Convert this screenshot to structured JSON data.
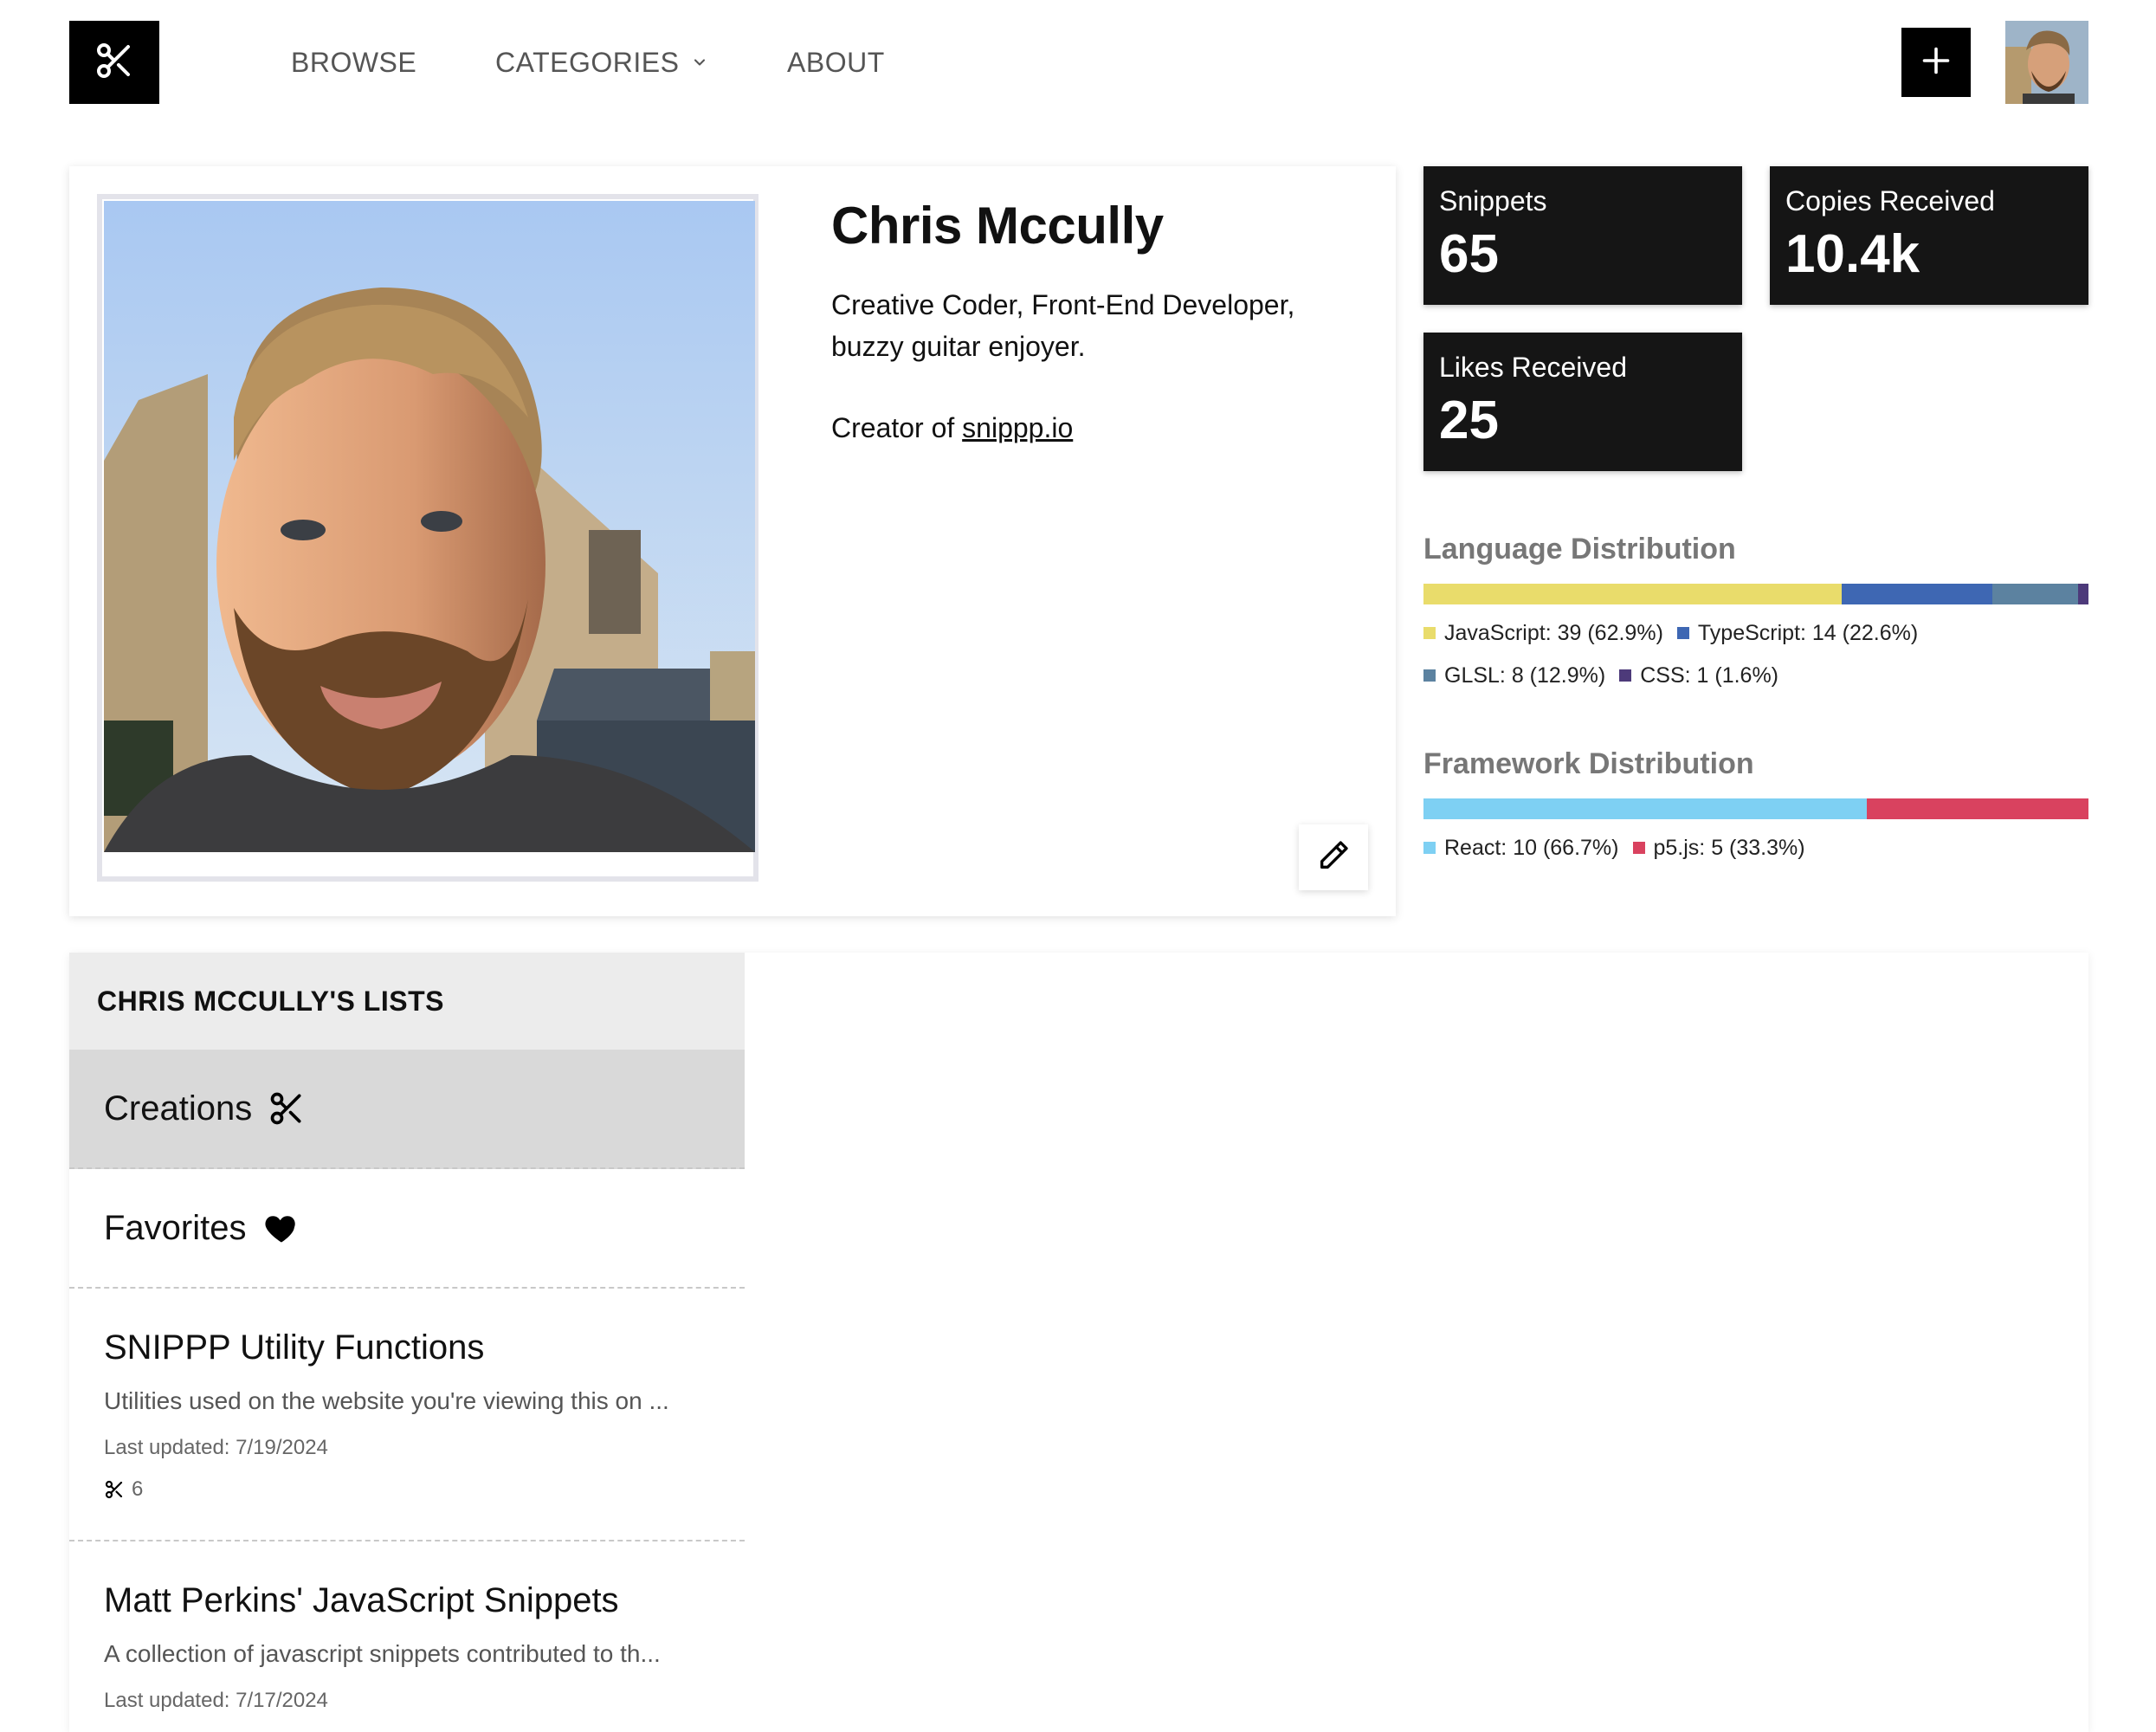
{
  "header": {
    "nav": {
      "browse": "BROWSE",
      "categories": "CATEGORIES",
      "about": "ABOUT"
    },
    "icons": {
      "logo": "scissors-icon",
      "add": "plus-icon",
      "dropdown": "chevron-down-icon"
    }
  },
  "profile": {
    "name": "Chris Mccully",
    "bio": "Creative Coder, Front-End Developer, buzzy guitar enjoyer.",
    "creator_prefix": "Creator of",
    "creator_link": "snippp.io",
    "edit_icon": "pencil-icon"
  },
  "stats": {
    "snippets": {
      "label": "Snippets",
      "value": "65"
    },
    "copies": {
      "label": "Copies Received",
      "value": "10.4k"
    },
    "likes": {
      "label": "Likes Received",
      "value": "25"
    }
  },
  "language_distribution": {
    "title": "Language Distribution",
    "items": [
      {
        "label": "JavaScript: 39 (62.9%)",
        "percent": 62.9,
        "color": "#e9dc6b"
      },
      {
        "label": "TypeScript: 14 (22.6%)",
        "percent": 22.6,
        "color": "#3e67b3"
      },
      {
        "label": "GLSL: 8 (12.9%)",
        "percent": 12.9,
        "color": "#5c82a0"
      },
      {
        "label": "CSS: 1 (1.6%)",
        "percent": 1.6,
        "color": "#4d3a7a"
      }
    ]
  },
  "framework_distribution": {
    "title": "Framework Distribution",
    "items": [
      {
        "label": "React: 10 (66.7%)",
        "percent": 66.7,
        "color": "#7ed0f3"
      },
      {
        "label": "p5.js: 5 (33.3%)",
        "percent": 33.3,
        "color": "#d9425f"
      }
    ]
  },
  "lists": {
    "header": "CHRIS MCCULLY'S LISTS",
    "creations": "Creations",
    "favorites": "Favorites",
    "items": [
      {
        "title": "SNIPPP Utility Functions",
        "description": "Utilities used on the website you're viewing this on ...",
        "updated": "Last updated: 7/19/2024",
        "count": "6"
      },
      {
        "title": "Matt Perkins' JavaScript Snippets",
        "description": "A collection of javascript snippets contributed to th...",
        "updated": "Last updated: 7/17/2024"
      }
    ]
  }
}
